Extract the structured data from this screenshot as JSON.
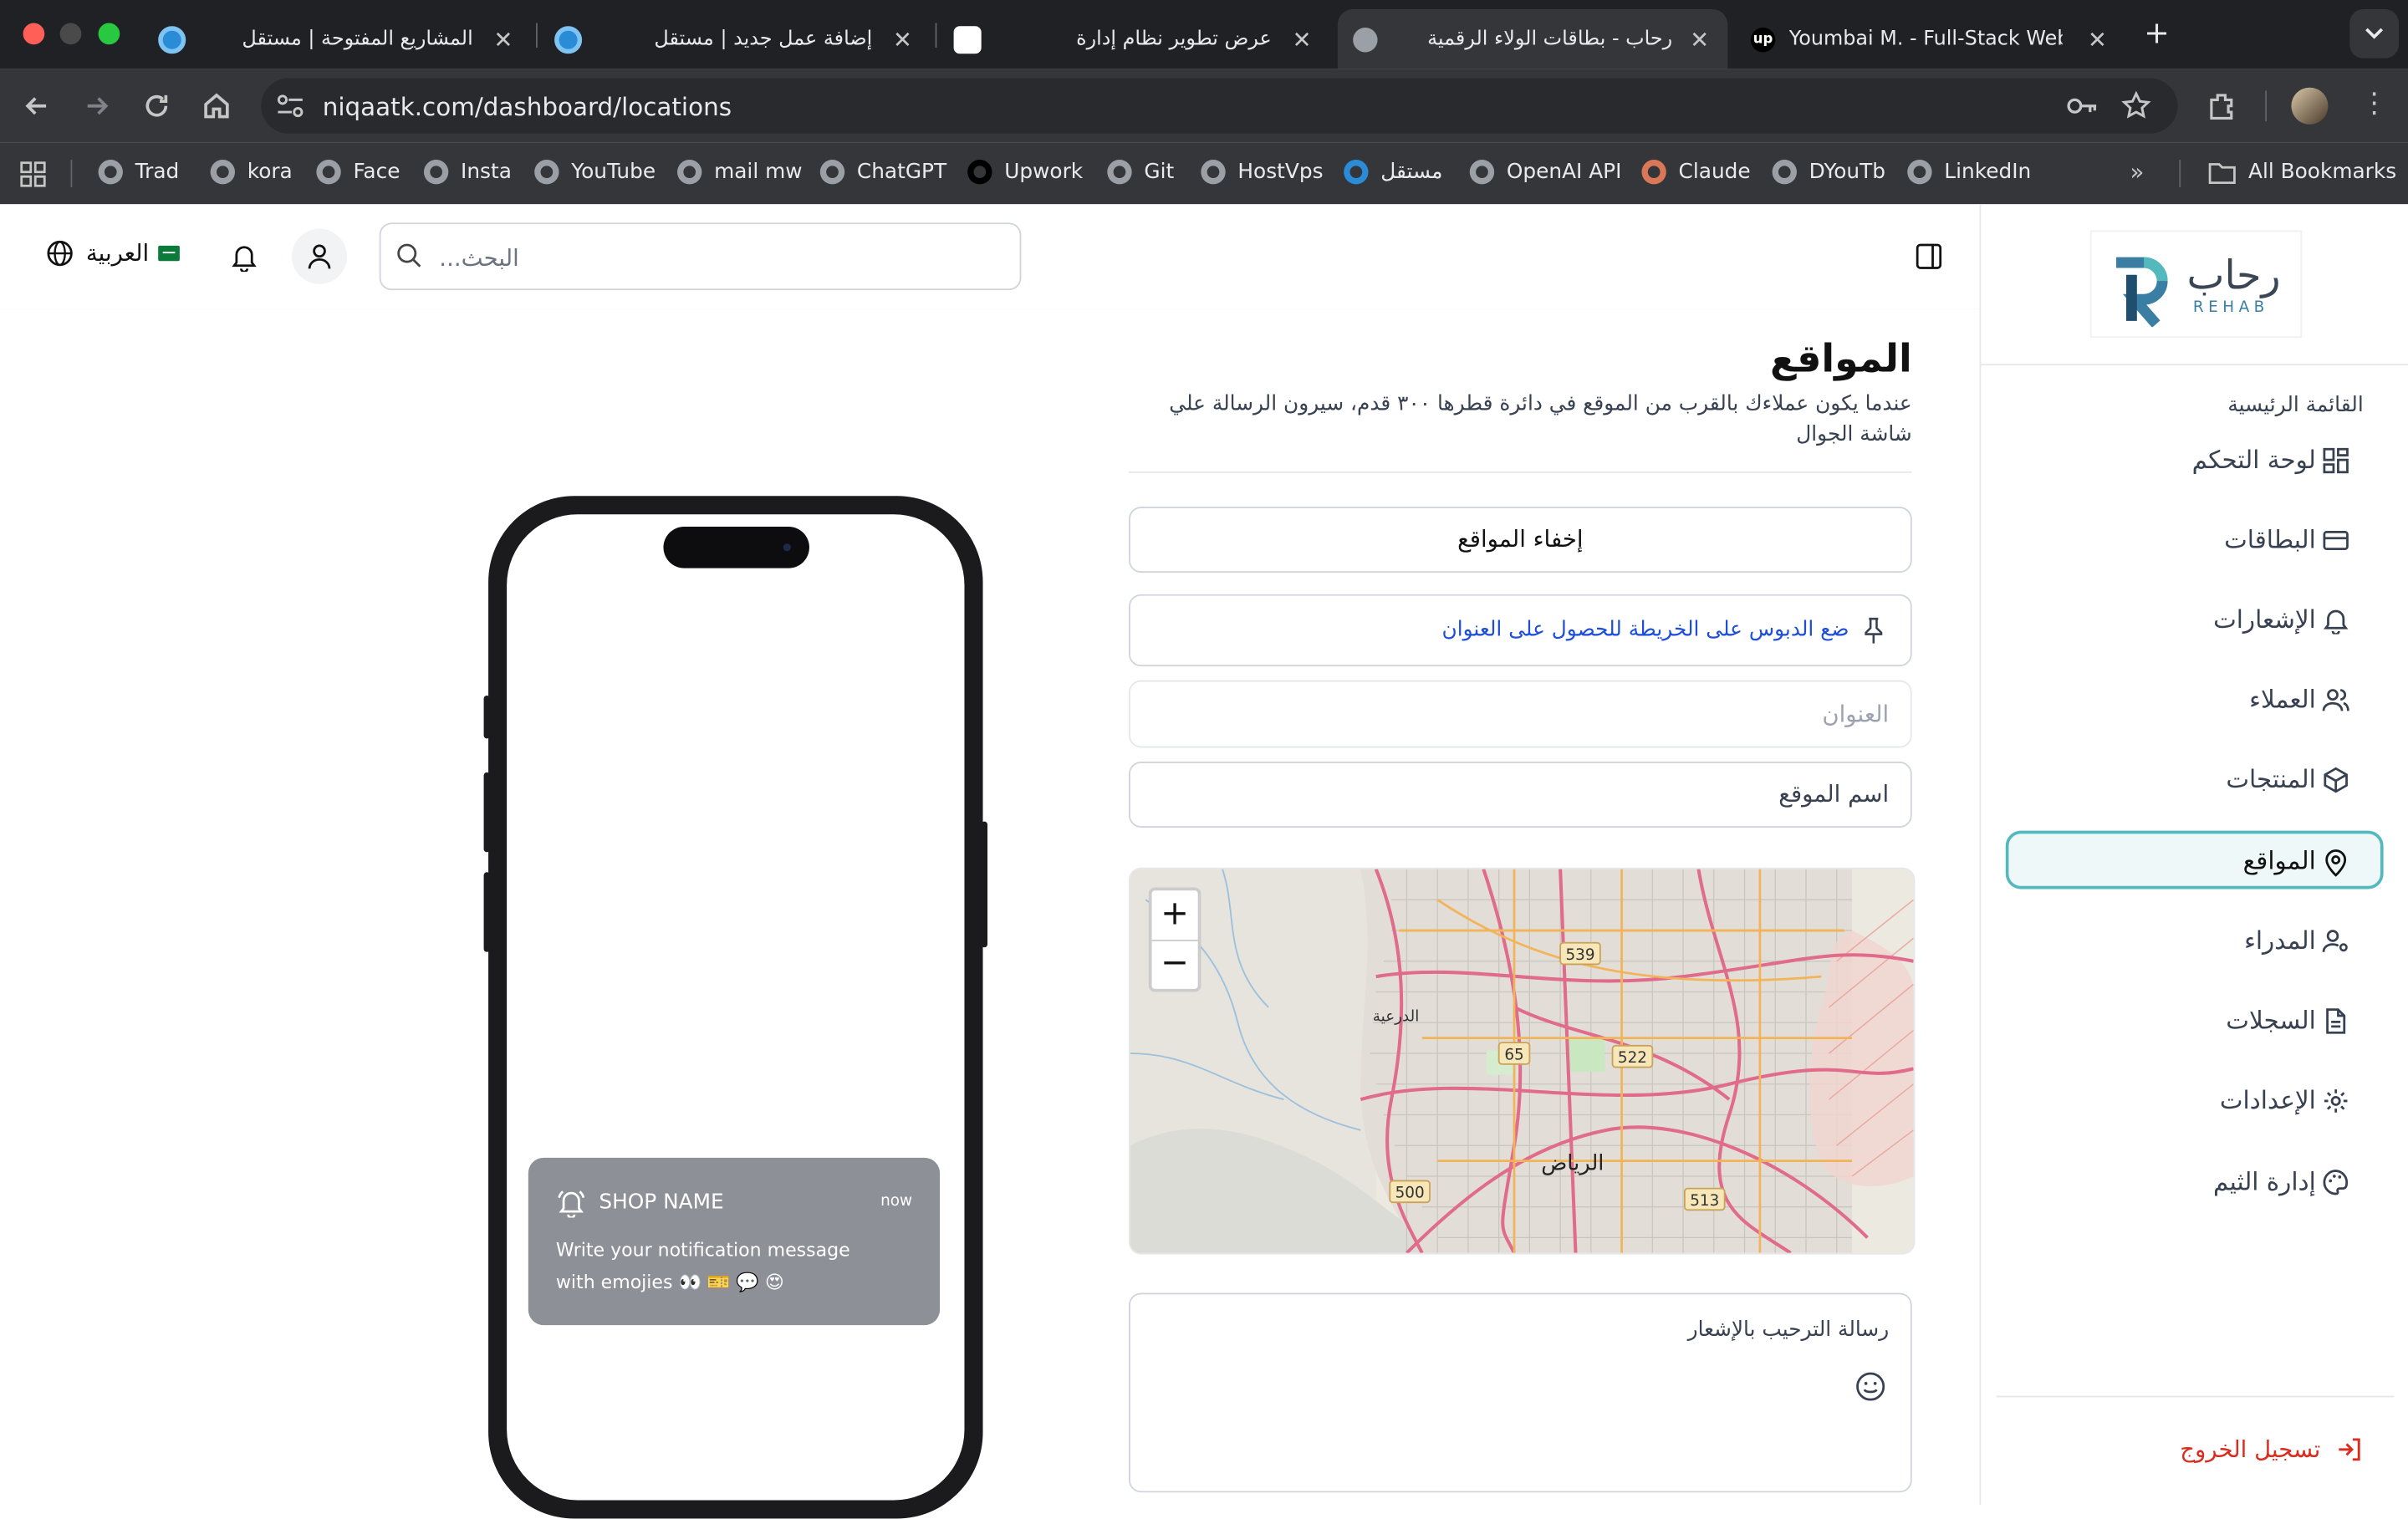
{
  "browser": {
    "tabs": [
      {
        "title": "المشاريع المفتوحة | مستقل",
        "favicon": "mostaql-icon"
      },
      {
        "title": "إضافة عمل جديد | مستقل",
        "favicon": "mostaql-icon"
      },
      {
        "title": "عرض تطوير نظام إدارة",
        "favicon": "chatgpt-icon"
      },
      {
        "title": "رحاب - بطاقات الولاء الرقمية",
        "favicon": "globe-icon",
        "active": true
      },
      {
        "title": "Youmbai M. - Full-Stack Web",
        "favicon": "upwork-icon"
      }
    ],
    "url": "niqaatk.com/dashboard/locations",
    "bookmarks": [
      {
        "label": "Trad"
      },
      {
        "label": "kora"
      },
      {
        "label": "Face"
      },
      {
        "label": "Insta"
      },
      {
        "label": "YouTube"
      },
      {
        "label": "mail mw"
      },
      {
        "label": "ChatGPT"
      },
      {
        "label": "Upwork"
      },
      {
        "label": "Git"
      },
      {
        "label": "HostVps"
      },
      {
        "label": "مستقل"
      },
      {
        "label": "OpenAI API"
      },
      {
        "label": "Claude"
      },
      {
        "label": "DYouTb"
      },
      {
        "label": "LinkedIn"
      }
    ],
    "all_bookmarks": "All Bookmarks"
  },
  "header": {
    "language_label": "العربية",
    "search_placeholder": "البحث..."
  },
  "sidebar": {
    "logo_text": "رحاب",
    "logo_sub": "REHAB",
    "section_title": "القائمة الرئيسية",
    "items": [
      {
        "label": "لوحة التحكم",
        "icon": "grid-icon"
      },
      {
        "label": "البطاقات",
        "icon": "card-icon"
      },
      {
        "label": "الإشعارات",
        "icon": "bell-icon"
      },
      {
        "label": "العملاء",
        "icon": "users-icon"
      },
      {
        "label": "المنتجات",
        "icon": "box-icon"
      },
      {
        "label": "المواقع",
        "icon": "map-pin-icon",
        "active": true
      },
      {
        "label": "المدراء",
        "icon": "user-cog-icon"
      },
      {
        "label": "السجلات",
        "icon": "file-icon"
      },
      {
        "label": "الإعدادات",
        "icon": "gear-icon"
      },
      {
        "label": "إدارة الثيم",
        "icon": "palette-icon"
      }
    ],
    "logout_label": "تسجيل الخروج",
    "colors": {
      "accent": "#54b9bd",
      "logout": "#d92d20"
    }
  },
  "page": {
    "title": "المواقع",
    "description": "عندما يكون عملاءك بالقرب من الموقع في دائرة قطرها ٣٠٠ قدم، سيرون الرسالة علي شاشة الجوال",
    "hide_locations_button": "إخفاء المواقع",
    "pin_hint": "ضع الدبوس على الخريطة للحصول على العنوان",
    "address_placeholder": "العنوان",
    "location_name_placeholder": "اسم الموقع",
    "welcome_placeholder": "رسالة الترحيب بالإشعار"
  },
  "map": {
    "zoom_in": "+",
    "zoom_out": "−",
    "labels": {
      "city": "الرياض",
      "district": "الدرعية"
    },
    "road_numbers": [
      "539",
      "65",
      "522",
      "500",
      "513"
    ]
  },
  "phone_preview": {
    "shop_name": "SHOP NAME",
    "time": "now",
    "message": "Write your notification message with emojies 👀 🎫 💬 😍"
  }
}
